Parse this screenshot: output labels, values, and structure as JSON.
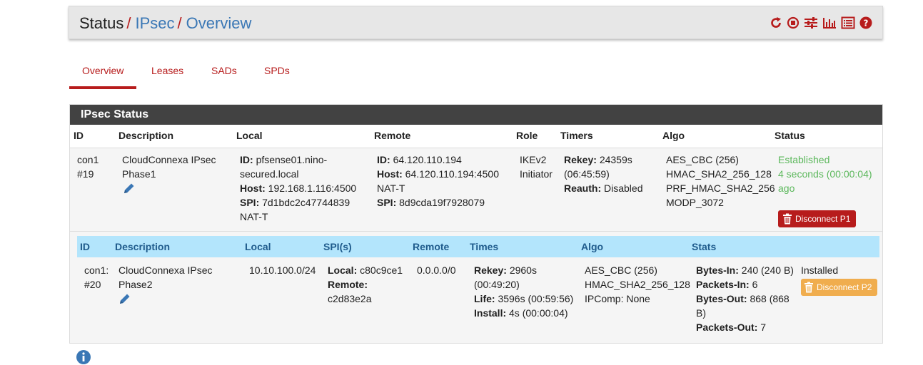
{
  "breadcrumb": {
    "status": "Status",
    "ipsec": "IPsec",
    "overview": "Overview",
    "separator": "/"
  },
  "toolbar_icons": [
    "restart-service-icon",
    "stop-service-icon",
    "settings-sliders-icon",
    "chart-icon",
    "log-list-icon",
    "help-icon"
  ],
  "tabs": [
    {
      "label": "Overview",
      "active": true
    },
    {
      "label": "Leases",
      "active": false
    },
    {
      "label": "SADs",
      "active": false
    },
    {
      "label": "SPDs",
      "active": false
    }
  ],
  "panel": {
    "title": "IPsec Status",
    "headers": {
      "id": "ID",
      "description": "Description",
      "local": "Local",
      "remote": "Remote",
      "role": "Role",
      "timers": "Timers",
      "algo": "Algo",
      "status": "Status"
    },
    "p1": {
      "id_line1": "con1",
      "id_line2": "#19",
      "desc_line1": "CloudConnexa IPsec",
      "desc_line2": "Phase1",
      "local_id_label": "ID:",
      "local_id_line1": "pfsense01.nino-",
      "local_id_line2": "secured.local",
      "local_host_label": "Host:",
      "local_host": "192.168.1.116:4500",
      "local_spi_label": "SPI:",
      "local_spi": "7d1bdc2c47744839",
      "local_natt": "NAT-T",
      "remote_id_label": "ID:",
      "remote_id": "64.120.110.194",
      "remote_host_label": "Host:",
      "remote_host": "64.120.110.194:4500",
      "remote_natt": "NAT-T",
      "remote_spi_label": "SPI:",
      "remote_spi": "8d9cda19f7928079",
      "role_line1": "IKEv2",
      "role_line2": "Initiator",
      "rekey_label": "Rekey:",
      "rekey": "24359s",
      "rekey_time": "(06:45:59)",
      "reauth_label": "Reauth:",
      "reauth": "Disabled",
      "algo": [
        "AES_CBC (256)",
        "HMAC_SHA2_256_128",
        "PRF_HMAC_SHA2_256",
        "MODP_3072"
      ],
      "status_line1": "Established",
      "status_line2": "4 seconds (00:00:04)",
      "status_line3": "ago",
      "disconnect_label": "Disconnect P1",
      "status_color": "#5cb85c"
    },
    "p2_headers": {
      "id": "ID",
      "description": "Description",
      "local": "Local",
      "spis": "SPI(s)",
      "remote": "Remote",
      "times": "Times",
      "algo": "Algo",
      "stats": "Stats"
    },
    "p2": {
      "id_line1": "con1:",
      "id_line2": "#20",
      "desc_line1": "CloudConnexa IPsec",
      "desc_line2": "Phase2",
      "local": "10.10.100.0/24",
      "spi_local_label": "Local:",
      "spi_local": "c80c9ce1",
      "spi_remote_label": "Remote:",
      "spi_remote": "c2d83e2a",
      "remote": "0.0.0.0/0",
      "rekey_label": "Rekey:",
      "rekey": "2960s",
      "rekey_time": "(00:49:20)",
      "life_label": "Life:",
      "life": "3596s (00:59:56)",
      "install_label": "Install:",
      "install": "4s (00:00:04)",
      "algo": [
        "AES_CBC (256)",
        "HMAC_SHA2_256_128",
        "IPComp: None"
      ],
      "bytes_in_label": "Bytes-In:",
      "bytes_in": "240 (240 B)",
      "packets_in_label": "Packets-In:",
      "packets_in": "6",
      "bytes_out_label": "Bytes-Out:",
      "bytes_out_line1": "868 (868",
      "bytes_out_line2": "B)",
      "packets_out_label": "Packets-Out:",
      "packets_out": "7",
      "status": "Installed",
      "disconnect_label": "Disconnect P2"
    }
  },
  "colors": {
    "accent_red": "#b71c1c",
    "link_blue": "#3a77b5",
    "panel_header": "#424242",
    "subheader_bg": "#b3e5fc",
    "warning_orange": "#f0ad4e"
  }
}
